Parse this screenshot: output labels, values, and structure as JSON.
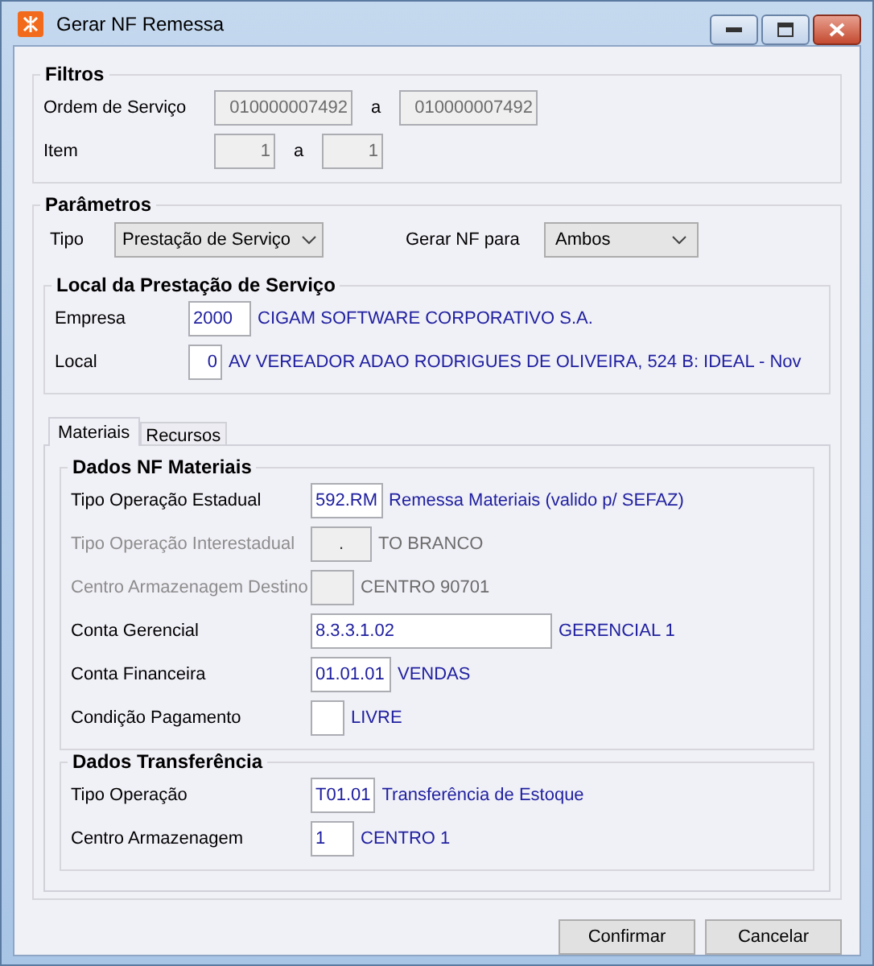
{
  "window": {
    "title": "Gerar NF Remessa"
  },
  "filtros": {
    "title": "Filtros",
    "rows": [
      {
        "label": "Ordem de Serviço",
        "from": "010000007492",
        "separator": "a",
        "to": "010000007492"
      },
      {
        "label": "Item",
        "from": "1",
        "separator": "a",
        "to": "1"
      }
    ]
  },
  "parametros": {
    "title": "Parâmetros",
    "tipo": {
      "label": "Tipo",
      "value": "Prestação de Serviço"
    },
    "gerar": {
      "label": "Gerar NF para",
      "value": "Ambos"
    },
    "local": {
      "title": "Local da Prestação de Serviço",
      "rows": [
        {
          "label": "Empresa",
          "code": "2000",
          "description": "CIGAM SOFTWARE CORPORATIVO S.A."
        },
        {
          "label": "Local",
          "code": "0",
          "description": "AV VEREADOR ADAO RODRIGUES DE OLIVEIRA, 524 B: IDEAL - Nov"
        }
      ]
    }
  },
  "tabs": [
    {
      "label": "Materiais",
      "selected": true
    },
    {
      "label": "Recursos",
      "selected": false
    }
  ],
  "sections": [
    {
      "title": "Dados NF Materiais",
      "rows": [
        {
          "label": "Tipo Operação Estadual",
          "code": "592.RM",
          "description": "Remessa Materiais (valido p/ SEFAZ)",
          "disabled": false
        },
        {
          "label": "Tipo Operação Interestadual",
          "code": ".",
          "description": "TO BRANCO",
          "disabled": true
        },
        {
          "label": "Centro Armazenagem Destino",
          "description": "CENTRO 90701",
          "disabled": true
        },
        {
          "label": "Conta Gerencial",
          "code": "8.3.3.1.02",
          "description": "GERENCIAL 1",
          "disabled": false
        },
        {
          "label": "Conta Financeira",
          "code": "01.01.01",
          "description": "VENDAS",
          "disabled": false
        },
        {
          "label": "Condição Pagamento",
          "description": "LIVRE",
          "disabled": false
        }
      ]
    },
    {
      "title": "Dados Transferência",
      "rows": [
        {
          "label": "Tipo Operação",
          "code": "T01.01",
          "description": "Transferência de Estoque",
          "disabled": false
        },
        {
          "label": "Centro Armazenagem",
          "code": "1",
          "description": "CENTRO 1",
          "disabled": false
        }
      ]
    }
  ],
  "buttons": [
    "Confirmar",
    "Cancelar"
  ]
}
